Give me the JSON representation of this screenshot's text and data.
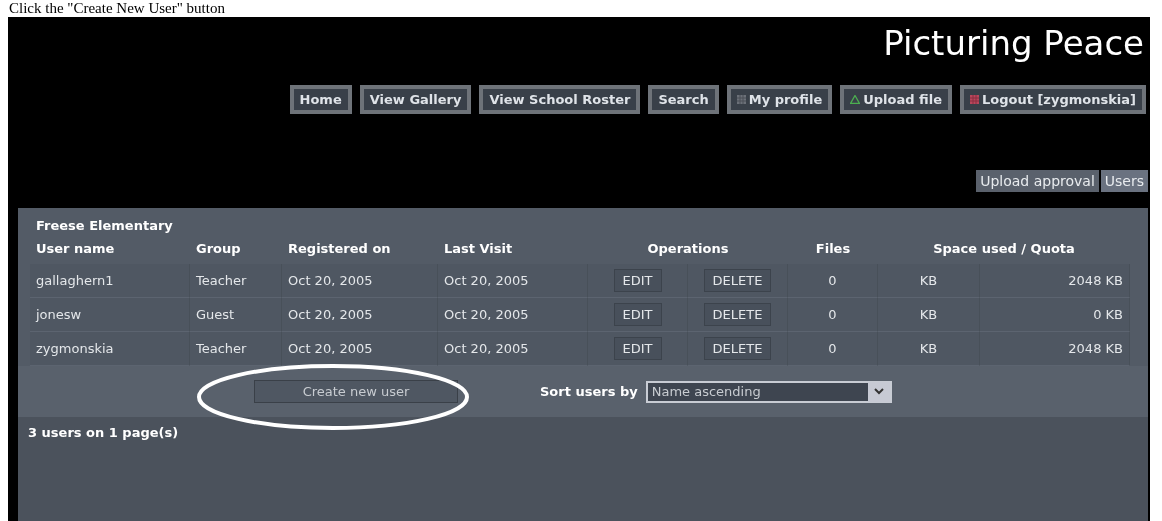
{
  "caption": "Click the \"Create New User\" button",
  "site_title": "Picturing Peace",
  "nav": [
    {
      "label": "Home",
      "kind": "plain"
    },
    {
      "label": "View Gallery",
      "kind": "plain"
    },
    {
      "label": "View School Roster",
      "kind": "plain"
    },
    {
      "label": "Search",
      "kind": "plain"
    },
    {
      "label": "My profile",
      "kind": "profile"
    },
    {
      "label": "Upload file",
      "kind": "upload"
    },
    {
      "label": "Logout [zygmonskia]",
      "kind": "logout"
    }
  ],
  "subtabs": [
    {
      "label": "Upload approval",
      "selected": false
    },
    {
      "label": "Users",
      "selected": true
    }
  ],
  "table": {
    "school": "Freese Elementary",
    "columns": [
      "User name",
      "Group",
      "Registered on",
      "Last Visit",
      "Operations",
      "Files",
      "Space used / Quota"
    ],
    "rows": [
      {
        "user": "gallaghern1",
        "group": "Teacher",
        "registered": "Oct 20, 2005",
        "last_visit": "Oct 20, 2005",
        "edit": "EDIT",
        "delete": "DELETE",
        "files": "0",
        "used": "KB",
        "quota": "2048 KB"
      },
      {
        "user": "jonesw",
        "group": "Guest",
        "registered": "Oct 20, 2005",
        "last_visit": "Oct 20, 2005",
        "edit": "EDIT",
        "delete": "DELETE",
        "files": "0",
        "used": "KB",
        "quota": "0 KB"
      },
      {
        "user": "zygmonskia",
        "group": "Teacher",
        "registered": "Oct 20, 2005",
        "last_visit": "Oct 20, 2005",
        "edit": "EDIT",
        "delete": "DELETE",
        "files": "0",
        "used": "KB",
        "quota": "2048 KB"
      }
    ],
    "create_button": "Create new user",
    "sort_label": "Sort users by",
    "sort_value": "Name ascending",
    "status": "3 users on 1 page(s)"
  }
}
